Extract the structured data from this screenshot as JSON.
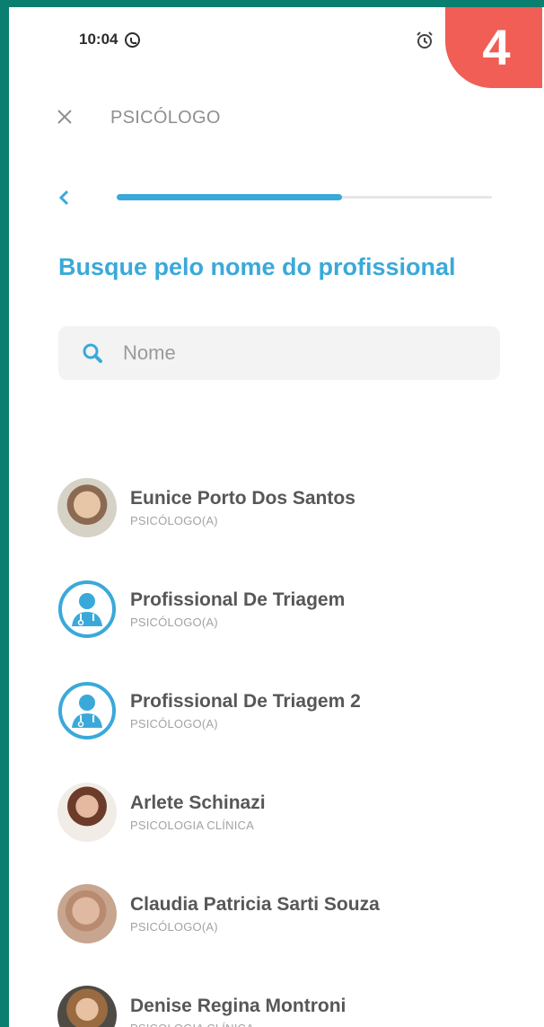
{
  "status_bar": {
    "time": "10:04"
  },
  "step_badge": "4",
  "header": {
    "title": "PSICÓLOGO"
  },
  "progress": {
    "value": 0.6
  },
  "heading": "Busque pelo nome do profissional",
  "search": {
    "placeholder": "Nome",
    "value": ""
  },
  "professionals": [
    {
      "name": "Eunice Porto Dos Santos",
      "role": "PSICÓLOGO(A)",
      "avatar": "photo"
    },
    {
      "name": "Profissional De Triagem",
      "role": "PSICÓLOGO(A)",
      "avatar": "doctor-placeholder-icon"
    },
    {
      "name": "Profissional De Triagem 2",
      "role": "PSICÓLOGO(A)",
      "avatar": "doctor-placeholder-icon"
    },
    {
      "name": "Arlete Schinazi",
      "role": "PSICOLOGIA CLÍNICA",
      "avatar": "photo"
    },
    {
      "name": "Claudia Patricia Sarti Souza",
      "role": "PSICÓLOGO(A)",
      "avatar": "photo"
    },
    {
      "name": "Denise Regina Montroni",
      "role": "PSICOLOGIA CLÍNICA",
      "avatar": "photo"
    }
  ],
  "colors": {
    "accent": "#3aa9d9",
    "badge": "#f05e56",
    "frame": "#0a7f6f"
  }
}
